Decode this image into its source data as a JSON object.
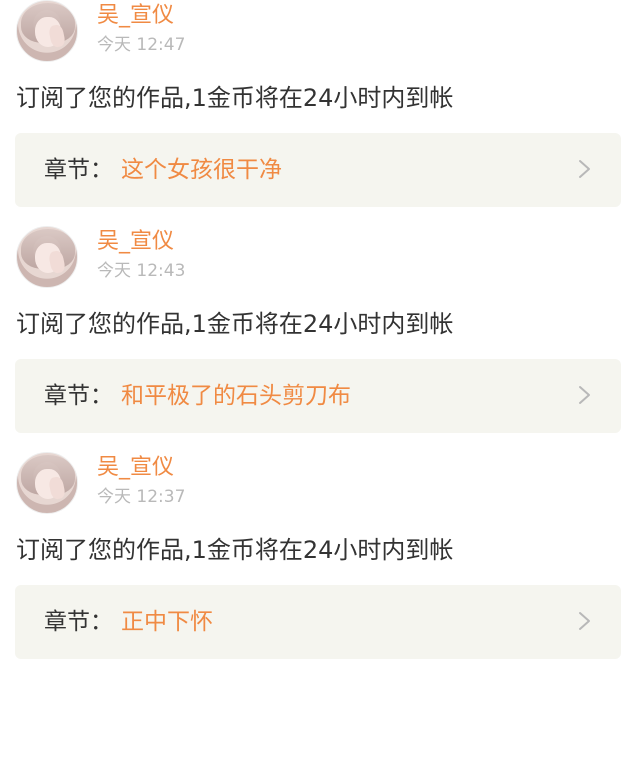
{
  "notifications": [
    {
      "user": "吴_宣仪",
      "time": "今天 12:47",
      "message": "订阅了您的作品,1金币将在24小时内到帐",
      "chapter_prefix": "章节：",
      "chapter_title": "这个女孩很干净"
    },
    {
      "user": "吴_宣仪",
      "time": "今天 12:43",
      "message": "订阅了您的作品,1金币将在24小时内到帐",
      "chapter_prefix": "章节：",
      "chapter_title": "和平极了的石头剪刀布"
    },
    {
      "user": "吴_宣仪",
      "time": "今天 12:37",
      "message": "订阅了您的作品,1金币将在24小时内到帐",
      "chapter_prefix": "章节：",
      "chapter_title": "正中下怀"
    }
  ],
  "colors": {
    "accent": "#f08a43",
    "text": "#333333",
    "muted": "#b9b9b9",
    "chapter_bg": "#f5f5ef",
    "separator": "#f2f2f2"
  },
  "icons": {
    "avatar": "avatar-icon",
    "chevron": "chevron-right-icon"
  }
}
